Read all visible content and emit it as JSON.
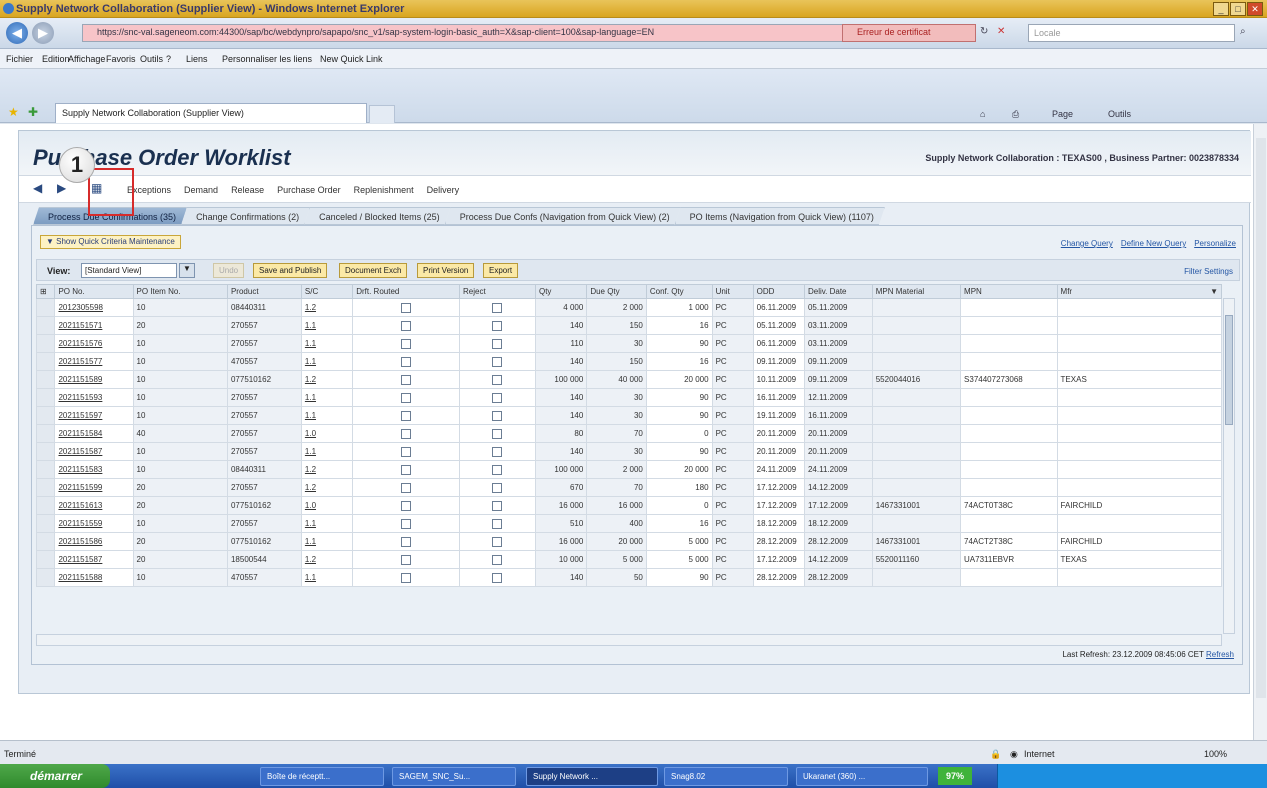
{
  "browser": {
    "title": "Supply Network Collaboration (Supplier View) - Windows Internet Explorer",
    "url": "https://snc-val.sageneom.com:44300/sap/bc/webdynpro/sapapo/snc_v1/sap-system-login-basic_auth=X&sap-client=100&sap-language=EN",
    "cert_error": "Erreur de certificat",
    "search_placeholder": "Locale",
    "menu": [
      "Fichier",
      "Edition",
      "Affichage",
      "Favoris",
      "Outils",
      "?"
    ],
    "links_label": "Liens",
    "fav_links": [
      "Personnaliser les liens",
      "New Quick Link"
    ],
    "tab_title": "Supply Network Collaboration (Supplier View)",
    "cmd_page": "Page",
    "cmd_tools": "Outils"
  },
  "app": {
    "title": "Purchase Order Worklist",
    "header_info": "Supply Network Collaboration : TEXAS00 , Business Partner: 0023878334",
    "main_tabs": [
      "Exceptions",
      "Demand",
      "Release",
      "Purchase Order",
      "Replenishment",
      "Delivery"
    ],
    "sub_tabs": [
      "Process Due Confirmations (35)",
      "Change Confirmations (2)",
      "Canceled / Blocked Items (25)",
      "Process Due Confs (Navigation from Quick View) (2)",
      "PO Items (Navigation from Quick View) (1107)"
    ],
    "quick_criteria": "Show Quick Criteria Maintenance",
    "top_links": [
      "Change Query",
      "Define New Query",
      "Personalize"
    ],
    "view_label": "View:",
    "view_value": "[Standard View]",
    "buttons": [
      "Undo",
      "Save and Publish",
      "Document Exch",
      "Print Version",
      "Export"
    ],
    "filter_settings": "Filter  Settings",
    "last_refresh": "Last Refresh: 23.12.2009 08:45:06 CET",
    "refresh_link": "Refresh",
    "callout_number": "1"
  },
  "table": {
    "columns": [
      "PO No.",
      "PO Item No.",
      "Product",
      "S/C",
      "Drft. Routed",
      "Reject",
      "Qty",
      "Due Qty",
      "Conf. Qty",
      "Unit",
      "ODD",
      "Deliv. Date",
      "MPN Material",
      "MPN",
      "Mfr"
    ],
    "rows": [
      {
        "po": "2012305598",
        "item": "10",
        "prod": "08440311",
        "sc": "1.2",
        "qty": "4 000",
        "due": "2 000",
        "conf": "1 000",
        "unit": "PC",
        "odd": "06.11.2009",
        "dd": "05.11.2009",
        "mpnmat": "",
        "mpn": "",
        "mfr": ""
      },
      {
        "po": "2021151571",
        "item": "20",
        "prod": "270557",
        "sc": "1.1",
        "qty": "140",
        "due": "150",
        "conf": "16",
        "unit": "PC",
        "odd": "05.11.2009",
        "dd": "03.11.2009",
        "mpnmat": "",
        "mpn": "",
        "mfr": ""
      },
      {
        "po": "2021151576",
        "item": "10",
        "prod": "270557",
        "sc": "1.1",
        "qty": "110",
        "due": "30",
        "conf": "90",
        "unit": "PC",
        "odd": "06.11.2009",
        "dd": "03.11.2009",
        "mpnmat": "",
        "mpn": "",
        "mfr": ""
      },
      {
        "po": "2021151577",
        "item": "10",
        "prod": "470557",
        "sc": "1.1",
        "qty": "140",
        "due": "150",
        "conf": "16",
        "unit": "PC",
        "odd": "09.11.2009",
        "dd": "09.11.2009",
        "mpnmat": "",
        "mpn": "",
        "mfr": ""
      },
      {
        "po": "2021151589",
        "item": "10",
        "prod": "077510162",
        "sc": "1.2",
        "qty": "100 000",
        "due": "40 000",
        "conf": "20 000",
        "unit": "PC",
        "odd": "10.11.2009",
        "dd": "09.11.2009",
        "mpnmat": "5520044016",
        "mpn": "S374407273068",
        "mfr": "TEXAS"
      },
      {
        "po": "2021151593",
        "item": "10",
        "prod": "270557",
        "sc": "1.1",
        "qty": "140",
        "due": "30",
        "conf": "90",
        "unit": "PC",
        "odd": "16.11.2009",
        "dd": "12.11.2009",
        "mpnmat": "",
        "mpn": "",
        "mfr": ""
      },
      {
        "po": "2021151597",
        "item": "10",
        "prod": "270557",
        "sc": "1.1",
        "qty": "140",
        "due": "30",
        "conf": "90",
        "unit": "PC",
        "odd": "19.11.2009",
        "dd": "16.11.2009",
        "mpnmat": "",
        "mpn": "",
        "mfr": ""
      },
      {
        "po": "2021151584",
        "item": "40",
        "prod": "270557",
        "sc": "1.0",
        "qty": "80",
        "due": "70",
        "conf": "0",
        "unit": "PC",
        "odd": "20.11.2009",
        "dd": "20.11.2009",
        "mpnmat": "",
        "mpn": "",
        "mfr": ""
      },
      {
        "po": "2021151587",
        "item": "10",
        "prod": "270557",
        "sc": "1.1",
        "qty": "140",
        "due": "30",
        "conf": "90",
        "unit": "PC",
        "odd": "20.11.2009",
        "dd": "20.11.2009",
        "mpnmat": "",
        "mpn": "",
        "mfr": ""
      },
      {
        "po": "2021151583",
        "item": "10",
        "prod": "08440311",
        "sc": "1.2",
        "qty": "100 000",
        "due": "2 000",
        "conf": "20 000",
        "unit": "PC",
        "odd": "24.11.2009",
        "dd": "24.11.2009",
        "mpnmat": "",
        "mpn": "",
        "mfr": ""
      },
      {
        "po": "2021151599",
        "item": "20",
        "prod": "270557",
        "sc": "1.2",
        "qty": "670",
        "due": "70",
        "conf": "180",
        "unit": "PC",
        "odd": "17.12.2009",
        "dd": "14.12.2009",
        "mpnmat": "",
        "mpn": "",
        "mfr": ""
      },
      {
        "po": "2021151613",
        "item": "20",
        "prod": "077510162",
        "sc": "1.0",
        "qty": "16 000",
        "due": "16 000",
        "conf": "0",
        "unit": "PC",
        "odd": "17.12.2009",
        "dd": "17.12.2009",
        "mpnmat": "1467331001",
        "mpn": "74ACT0T38C",
        "mfr": "FAIRCHILD"
      },
      {
        "po": "2021151559",
        "item": "10",
        "prod": "270557",
        "sc": "1.1",
        "qty": "510",
        "due": "400",
        "conf": "16",
        "unit": "PC",
        "odd": "18.12.2009",
        "dd": "18.12.2009",
        "mpnmat": "",
        "mpn": "",
        "mfr": ""
      },
      {
        "po": "2021151586",
        "item": "20",
        "prod": "077510162",
        "sc": "1.1",
        "qty": "16 000",
        "due": "20 000",
        "conf": "5 000",
        "unit": "PC",
        "odd": "28.12.2009",
        "dd": "28.12.2009",
        "mpnmat": "1467331001",
        "mpn": "74ACT2T38C",
        "mfr": "FAIRCHILD"
      },
      {
        "po": "2021151587",
        "item": "20",
        "prod": "18500544",
        "sc": "1.2",
        "qty": "10 000",
        "due": "5 000",
        "conf": "5 000",
        "unit": "PC",
        "odd": "17.12.2009",
        "dd": "14.12.2009",
        "mpnmat": "5520011160",
        "mpn": "UA7311EBVR",
        "mfr": "TEXAS"
      },
      {
        "po": "2021151588",
        "item": "10",
        "prod": "470557",
        "sc": "1.1",
        "qty": "140",
        "due": "50",
        "conf": "90",
        "unit": "PC",
        "odd": "28.12.2009",
        "dd": "28.12.2009",
        "mpnmat": "",
        "mpn": "",
        "mfr": ""
      }
    ]
  },
  "status": {
    "left": "Terminé",
    "zone": "Internet",
    "zoom": "100%"
  },
  "taskbar": {
    "start": "démarrer",
    "tasks": [
      "Boîte de réceptt...",
      "SAGEM_SNC_Su...",
      "Supply Network ...",
      "Snag8.02",
      "Ukaranet (360) ..."
    ],
    "percent": "97%"
  },
  "colors": {
    "callout": "#d62b2b",
    "title_bar": "#d9a520",
    "link": "#2456a4",
    "button": "#fbe9a6"
  }
}
